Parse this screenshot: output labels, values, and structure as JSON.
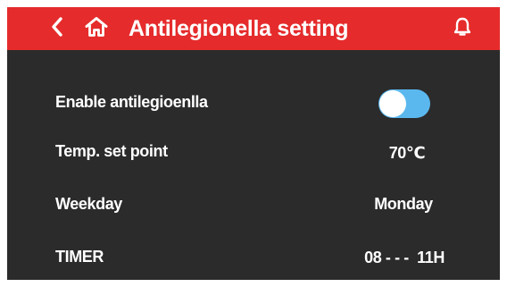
{
  "header": {
    "title": "Antilegionella setting",
    "back_icon": "chevron-left-icon",
    "home_icon": "home-icon",
    "bell_icon": "bell-icon"
  },
  "settings": [
    {
      "label": "Enable antilegioenlla",
      "toggle_on": true
    },
    {
      "label": "Temp. set point",
      "value": "70℃"
    },
    {
      "label": "Weekday",
      "value": "Monday"
    },
    {
      "label": "TIMER",
      "value": "08 - - -  11H"
    }
  ],
  "colors": {
    "header_bg": "#e52b2b",
    "body_bg": "#2b2b2b",
    "toggle_on": "#5bb8ef",
    "text": "#ffffff"
  }
}
